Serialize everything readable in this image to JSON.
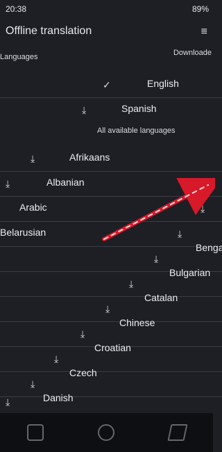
{
  "status": {
    "time": "20:38",
    "battery": "89%"
  },
  "appbar": {
    "title": "Offline translation",
    "menu_icon": "menu-icon"
  },
  "section": {
    "languages_header": "Languages",
    "download_header": "Downloade"
  },
  "languages_selected": [
    {
      "label": "English",
      "icon": "check-icon"
    },
    {
      "label": "Spanish",
      "icon": "download-icon"
    }
  ],
  "all_header": "All available languages",
  "languages_all": [
    {
      "label": "Afrikaans",
      "icon": "download-icon"
    },
    {
      "label": "Albanian",
      "icon": "download-icon"
    },
    {
      "label": "Arabic",
      "icon": "download-icon"
    },
    {
      "label": "Belarusian",
      "icon": "download-icon"
    },
    {
      "label": "Bengali",
      "icon": "download-icon"
    },
    {
      "label": "Bulgarian",
      "icon": "download-icon"
    },
    {
      "label": "Catalan",
      "icon": "download-icon"
    },
    {
      "label": "Chinese",
      "icon": "download-icon"
    },
    {
      "label": "Croatian",
      "icon": "download-icon"
    },
    {
      "label": "Czech",
      "icon": "download-icon"
    },
    {
      "label": "Danish",
      "icon": "download-icon"
    }
  ],
  "colors": {
    "background": "#1e1f24",
    "annotation_red": "#d7192a"
  },
  "navbar": {
    "left": "recent-apps",
    "center": "home",
    "right": "back"
  }
}
